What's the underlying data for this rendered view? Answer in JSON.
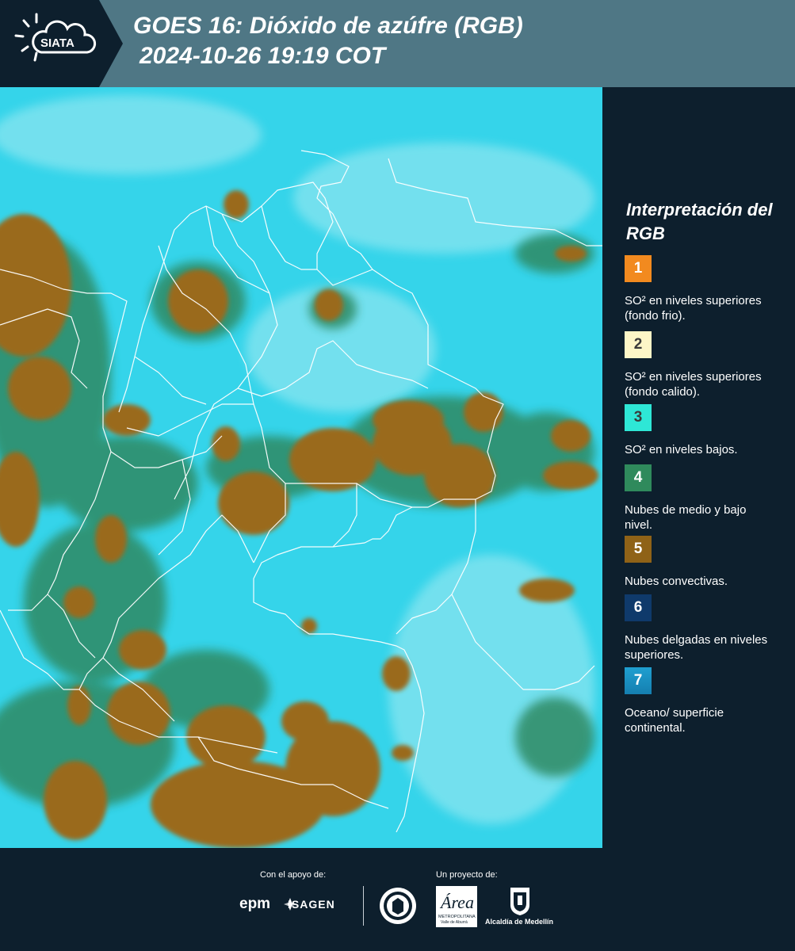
{
  "header": {
    "logo_text": "SIATA",
    "title_line1": "GOES 16: Dióxido de azúfre (RGB)",
    "title_line2": "2024-10-26 19:19 COT"
  },
  "legend": {
    "title": "Interpretación del RGB",
    "items": [
      {
        "number": "1",
        "color": "#f28a1f",
        "text": "SO² en niveles superiores (fondo frio)."
      },
      {
        "number": "2",
        "color": "#fdf6c7",
        "text": "SO² en niveles superiores (fondo calido)."
      },
      {
        "number": "3",
        "color": "#2ee7d6",
        "text": "SO² en niveles bajos."
      },
      {
        "number": "4",
        "color": "#2f8a5c",
        "text": "Nubes de medio y bajo nivel."
      },
      {
        "number": "5",
        "color": "#8f6217",
        "text": "Nubes convectivas."
      },
      {
        "number": "6",
        "color": "#0f3a6b",
        "text": "Nubes delgadas en niveles superiores."
      },
      {
        "number": "7",
        "color": "#1b8ec2",
        "text": "Oceano/ superficie continental."
      }
    ]
  },
  "footer": {
    "support_label": "Con el apoyo de:",
    "project_label": "Un proyecto de:",
    "epm": "epm",
    "isagen": "ISAGEN",
    "alcaldia": "Alcaldía de Medellín",
    "area_line1": "METROPOLITANA",
    "area_line2": "Valle de Aburrá"
  },
  "map_colors": {
    "background": "#2fd3ea",
    "convective": "#9a6a1e",
    "low_cloud": "#2e8a62",
    "borders": "#ffffff"
  }
}
